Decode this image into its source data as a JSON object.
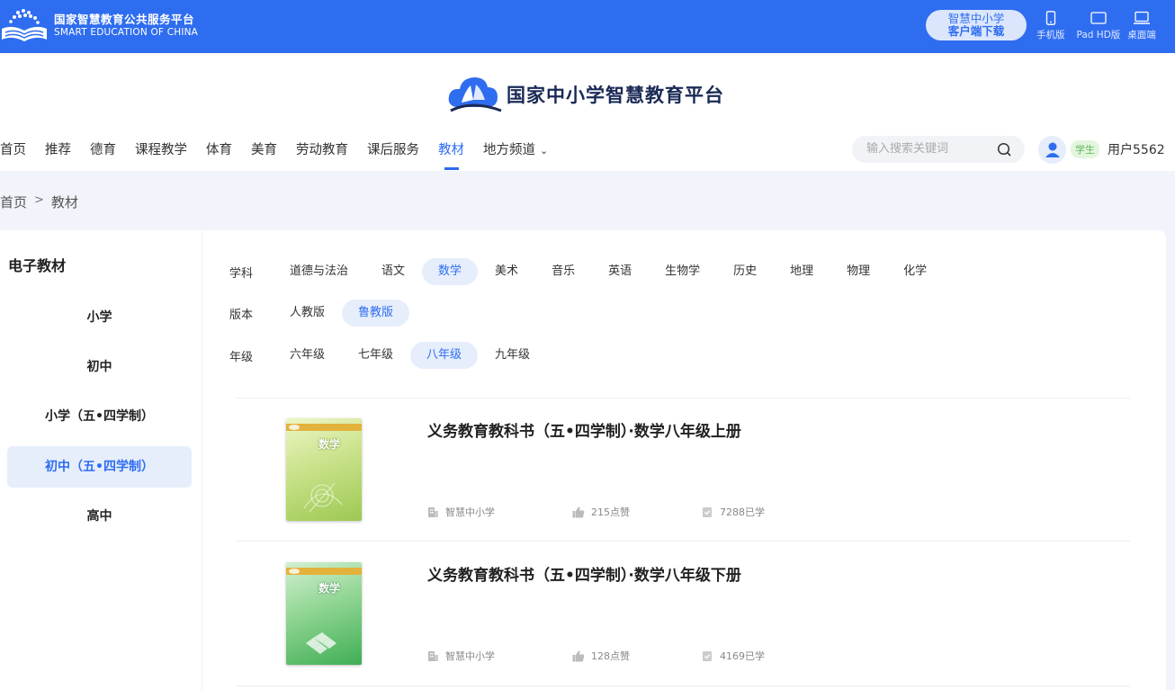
{
  "topbar": {
    "brand_cn": "国家智慧教育公共服务平台",
    "brand_en": "SMART EDUCATION OF CHINA",
    "download_line1": "智慧中小学",
    "download_line2": "客户端下载",
    "devices": [
      {
        "label": "手机版",
        "icon": "phone-icon"
      },
      {
        "label": "Pad HD版",
        "icon": "tablet-icon"
      },
      {
        "label": "桌面端",
        "icon": "laptop-icon"
      }
    ]
  },
  "header": {
    "site_title": "国家中小学智慧教育平台",
    "nav": [
      "首页",
      "推荐",
      "德育",
      "课程教学",
      "体育",
      "美育",
      "劳动教育",
      "课后服务",
      "教材",
      "地方频道"
    ],
    "nav_active": "教材",
    "search_placeholder": "输入搜索关键词",
    "role": "学生",
    "username": "用户5562"
  },
  "breadcrumb": {
    "home": "首页",
    "sep": ">",
    "current": "教材"
  },
  "sidebar": {
    "title": "电子教材",
    "items": [
      "小学",
      "初中",
      "小学（五•四学制）",
      "初中（五•四学制）",
      "高中"
    ],
    "active": "初中（五•四学制）"
  },
  "filters": {
    "subject": {
      "label": "学科",
      "options": [
        "道德与法治",
        "语文",
        "数学",
        "美术",
        "音乐",
        "英语",
        "生物学",
        "历史",
        "地理",
        "物理",
        "化学"
      ],
      "active": "数学"
    },
    "edition": {
      "label": "版本",
      "options": [
        "人教版",
        "鲁教版"
      ],
      "active": "鲁教版"
    },
    "grade": {
      "label": "年级",
      "options": [
        "六年级",
        "七年级",
        "八年级",
        "九年级"
      ],
      "active": "八年级"
    }
  },
  "books": [
    {
      "title": "义务教育教科书（五•四学制）·数学八年级上册",
      "cover_text": "数学",
      "publisher": "智慧中小学",
      "likes": "215点赞",
      "studied": "7288已学",
      "cover_colors": [
        "#e8f2b8",
        "#a7cf5a"
      ]
    },
    {
      "title": "义务教育教科书（五•四学制）·数学八年级下册",
      "cover_text": "数学",
      "publisher": "智慧中小学",
      "likes": "128点赞",
      "studied": "4169已学",
      "cover_colors": [
        "#bfe8c2",
        "#46b65a"
      ]
    }
  ],
  "colors": {
    "accent": "#2f6df0",
    "topbar": "#2f6df0",
    "active_bg": "#e6eefc"
  }
}
